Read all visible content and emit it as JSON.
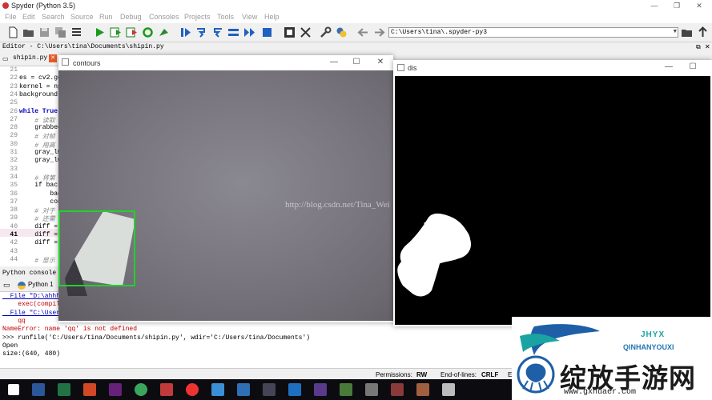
{
  "app": {
    "title": "Spyder (Python 3.5)",
    "controls": {
      "minimize": "—",
      "maximize": "❐",
      "close": "✕"
    }
  },
  "menu": [
    "File",
    "Edit",
    "Search",
    "Source",
    "Run",
    "Debug",
    "Consoles",
    "Projects",
    "Tools",
    "View",
    "Help"
  ],
  "toolbar": {
    "path": "C:\\Users\\tina\\.spyder-py3"
  },
  "editor": {
    "header": "Editor - C:\\Users\\tina\\Documents\\shipin.py",
    "tab": "shipin.py",
    "lines": [
      {
        "n": "21",
        "code": ""
      },
      {
        "n": "22",
        "code": "es = cv2.ge"
      },
      {
        "n": "23",
        "code": "kernel = np"
      },
      {
        "n": "24",
        "code": "background"
      },
      {
        "n": "25",
        "code": ""
      },
      {
        "n": "26",
        "code": "while True:"
      },
      {
        "n": "27",
        "code": "    # 读取"
      },
      {
        "n": "28",
        "code": "    grabbed"
      },
      {
        "n": "29",
        "code": "    # 对帧"
      },
      {
        "n": "30",
        "code": "    # 用高"
      },
      {
        "n": "31",
        "code": "    gray_lw"
      },
      {
        "n": "32",
        "code": "    gray_lw"
      },
      {
        "n": "33",
        "code": ""
      },
      {
        "n": "34",
        "code": "    # 将第"
      },
      {
        "n": "35",
        "code": "    if back"
      },
      {
        "n": "36",
        "code": "        bac"
      },
      {
        "n": "37",
        "code": "        con"
      },
      {
        "n": "38",
        "code": "    # 对于"
      },
      {
        "n": "39",
        "code": "    # 还需"
      },
      {
        "n": "40",
        "code": "    diff ="
      },
      {
        "n": "41",
        "code": "    diff ="
      },
      {
        "n": "42",
        "code": "    diff ="
      },
      {
        "n": "43",
        "code": ""
      },
      {
        "n": "44",
        "code": "    # 显示"
      }
    ]
  },
  "console": {
    "header": "Python console",
    "tab": "Python 1",
    "lines": [
      {
        "text": "  File \"D:\\ahhhh",
        "cls": "link"
      },
      {
        "text": "    exec(compil",
        "cls": "err"
      },
      {
        "text": "  File \"C:\\User",
        "cls": "link"
      },
      {
        "text": "    qq",
        "cls": "err"
      },
      {
        "text": "NameError: name 'qq' is not defined",
        "cls": "err"
      },
      {
        "text": ">>> runfile('C:/Users/tina/Documents/shipin.py', wdir='C:/Users/tina/Documents')",
        "cls": ""
      },
      {
        "text": "Open",
        "cls": ""
      },
      {
        "text": "size:(640, 480)",
        "cls": ""
      }
    ]
  },
  "statusbar": {
    "permissions_label": "Permissions:",
    "permissions_value": "RW",
    "eol_label": "End-of-lines:",
    "eol_value": "CRLF",
    "encoding_stub": "E"
  },
  "windows": {
    "contours": {
      "title": "contours"
    },
    "dis": {
      "title": "dis"
    }
  },
  "watermark": "http://blog.csdn.net/Tina_Wei",
  "logo": {
    "brand": "QINHANYOUXI",
    "brand_short": "JHYX",
    "cn": "绽放手游网",
    "url": "www.gxhuaer.com"
  },
  "colors": {
    "accent_green": "#23d12c",
    "error_red": "#c00000",
    "link_blue": "#0000c0"
  }
}
